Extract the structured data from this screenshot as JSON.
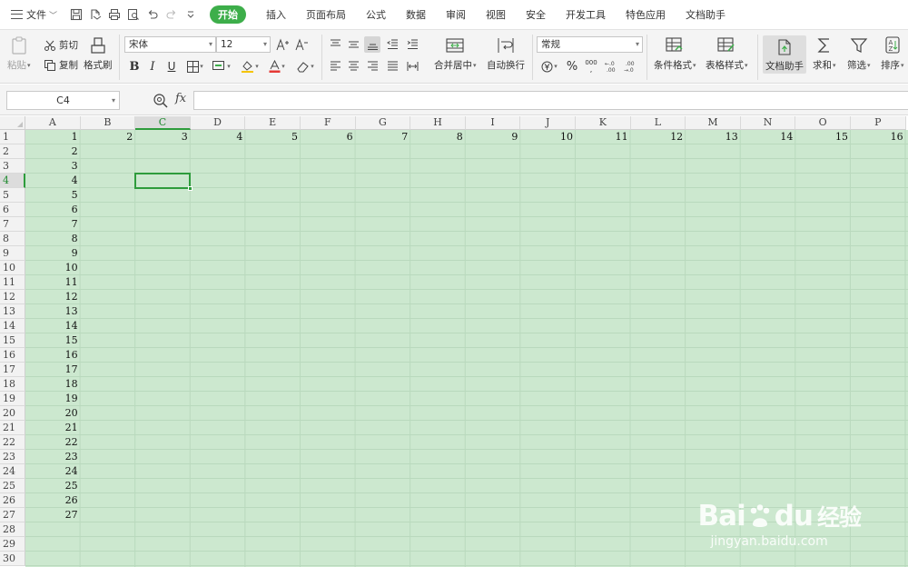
{
  "menubar": {
    "file_label": "文件",
    "tabs": [
      {
        "label": "开始",
        "active": true
      },
      {
        "label": "插入"
      },
      {
        "label": "页面布局"
      },
      {
        "label": "公式"
      },
      {
        "label": "数据"
      },
      {
        "label": "审阅"
      },
      {
        "label": "视图"
      },
      {
        "label": "安全"
      },
      {
        "label": "开发工具"
      },
      {
        "label": "特色应用"
      },
      {
        "label": "文档助手"
      }
    ]
  },
  "ribbon": {
    "paste": "粘贴",
    "cut": "剪切",
    "copy": "复制",
    "format_painter": "格式刷",
    "font_name": "宋体",
    "font_size": "12",
    "merge_center": "合并居中",
    "wrap_text": "自动换行",
    "number_format": "常规",
    "percent": "%",
    "thousands": "000",
    "inc_decimal": "+.0\n.00",
    "dec_decimal": ".00\n→.0",
    "conditional_format": "条件格式",
    "table_style": "表格样式",
    "doc_assistant": "文档助手",
    "sum": "求和",
    "filter": "筛选",
    "sort": "排序"
  },
  "formula_bar": {
    "name_box": "C4",
    "fx": "fx",
    "formula": ""
  },
  "sheet": {
    "columns": [
      "A",
      "B",
      "C",
      "D",
      "E",
      "F",
      "G",
      "H",
      "I",
      "J",
      "K",
      "L",
      "M",
      "N",
      "O",
      "P"
    ],
    "rows": [
      "1",
      "2",
      "3",
      "4",
      "5",
      "6",
      "7",
      "8",
      "9",
      "10",
      "11",
      "12",
      "13",
      "14",
      "15",
      "16",
      "17",
      "18",
      "19",
      "20",
      "21",
      "22",
      "23",
      "24",
      "25",
      "26",
      "27",
      "28",
      "29",
      "30"
    ],
    "selected_cell": "C4",
    "row1_values": [
      "1",
      "2",
      "3",
      "4",
      "5",
      "6",
      "7",
      "8",
      "9",
      "10",
      "11",
      "12",
      "13",
      "14",
      "15",
      "16"
    ],
    "colA_values": [
      "2",
      "3",
      "4",
      "5",
      "6",
      "7",
      "8",
      "9",
      "10",
      "11",
      "12",
      "13",
      "14",
      "15",
      "16",
      "17",
      "18",
      "19",
      "20",
      "21",
      "22",
      "23",
      "24",
      "25",
      "26",
      "27"
    ]
  },
  "watermark": {
    "brand_left": "Bai",
    "brand_right": "du",
    "brand_cn": "经验",
    "url": "jingyan.baidu.com"
  },
  "colors": {
    "accent": "#3dae4a",
    "grid_bg": "#cce8cf",
    "grid_line": "#b9d9bd",
    "selection": "#2e9c3c"
  }
}
